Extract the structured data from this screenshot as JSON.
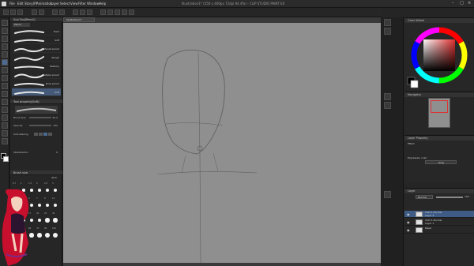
{
  "window": {
    "title": "Illustration1* (550 x 400px 72dpi 94.4%) - CLIP STUDIO PAINT EX"
  },
  "menu": [
    "File",
    "Edit",
    "Story(P)",
    "Animation",
    "Layer",
    "Select",
    "View",
    "Filter",
    "Window",
    "Help"
  ],
  "sub_tool_panel": {
    "header": "Sub Tool[Pencil]",
    "group": "Pencil",
    "brushes": [
      {
        "label": "Hard",
        "selected": false
      },
      {
        "label": "Soft",
        "selected": false
      },
      {
        "label": "Textured pencil",
        "selected": false
      },
      {
        "label": "Rough",
        "selected": false
      },
      {
        "label": "Sketchy",
        "selected": false
      },
      {
        "label": "Multiple pencil",
        "selected": false
      },
      {
        "label": "Drop pencil",
        "selected": false
      },
      {
        "label": "Soft",
        "selected": true
      }
    ]
  },
  "tool_property": {
    "header": "Tool property[Soft]",
    "brush_size_label": "Brush Size",
    "brush_size_value": "40.0",
    "opacity_label": "Opacity",
    "opacity_value": "100",
    "anti_aliasing_label": "Anti-aliasing",
    "stabilization_label": "Stabilization",
    "stabilization_value": "6"
  },
  "brush_size_panel": {
    "header": "Brush size",
    "value": "40.0",
    "sizes": [
      "0.7",
      "1",
      "1.5",
      "2",
      "2.5",
      "3",
      "4",
      "5",
      "6",
      "7",
      "8",
      "10",
      "12",
      "15",
      "17",
      "20",
      "25",
      "30",
      "40",
      "50",
      "60",
      "70",
      "80",
      "100"
    ]
  },
  "doc_tab": {
    "label": "Illustration1*"
  },
  "color_wheel": {
    "header": "Color Wheel"
  },
  "navigator": {
    "header": "Navigator"
  },
  "layer_property": {
    "header": "Layer Property",
    "effect_label": "Effect",
    "expression_label": "Expression color",
    "expression_value": "Gray"
  },
  "layer_panel": {
    "header": "Layer",
    "blend_mode": "Normal",
    "opacity": "100",
    "layers": [
      {
        "name": "100 % Normal\nLayer 3",
        "selected": true,
        "visible": true
      },
      {
        "name": "100 % Normal\nLayer 1",
        "selected": false,
        "visible": true
      },
      {
        "name": "Paper",
        "selected": false,
        "visible": true
      }
    ]
  },
  "colors": {
    "canvas_bg": "#8f8f8f",
    "selected": "#445a78",
    "main_color": "#000000",
    "sub_color": "#ffffff"
  }
}
